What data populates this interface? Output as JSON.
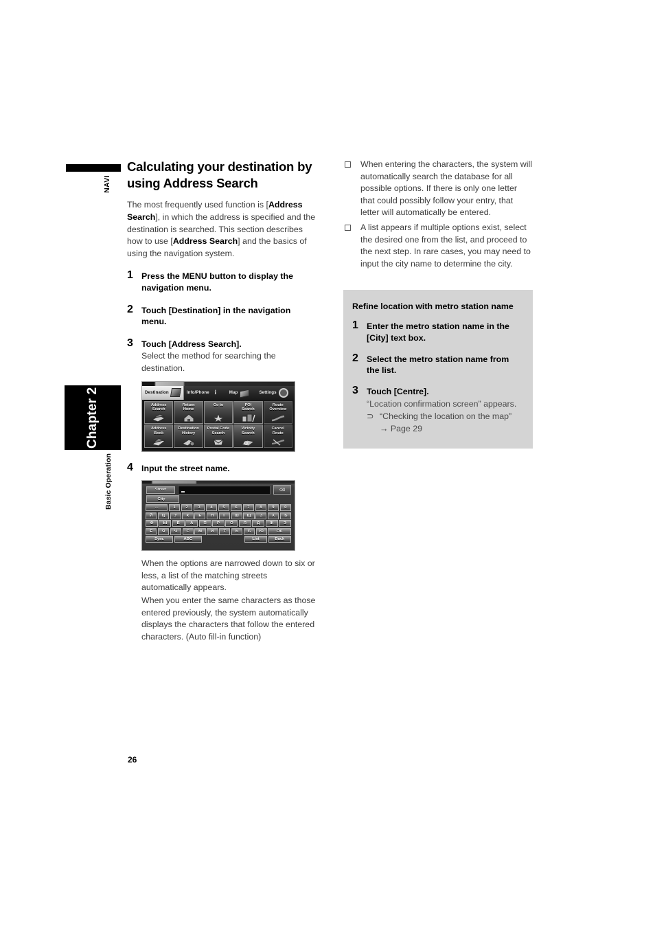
{
  "margin": {
    "navi_label": "NAVI",
    "chapter_label": "Chapter 2",
    "section_label": "Basic Operation",
    "page_number": "26"
  },
  "left_column": {
    "title": "Calculating your destination by using Address Search",
    "intro_parts": {
      "p1": "The most frequently used function is [",
      "b1": "Address Search",
      "p2": "], in which the address is specified and the destination is searched. This section describes how to use [",
      "b2": "Address Search",
      "p3": "] and the basics of using the navigation system."
    },
    "steps": [
      {
        "num": "1",
        "title": "Press the MENU button to display the navigation menu.",
        "desc": ""
      },
      {
        "num": "2",
        "title": "Touch [Destination] in the navigation menu.",
        "desc": ""
      },
      {
        "num": "3",
        "title": "Touch [Address Search].",
        "desc": "Select the method for searching the destination."
      },
      {
        "num": "4",
        "title": "Input the street name.",
        "desc": ""
      }
    ],
    "after_keyboard_text_1": "When the options are narrowed down to six or less, a list of the matching streets automatically appears.",
    "after_keyboard_text_2": "When you enter the same characters as those entered previously, the system automatically displays the characters that follow the entered characters. (Auto fill-in function)"
  },
  "nav_menu_screenshot": {
    "tabs": [
      {
        "label": "Destination",
        "icon": "flag-icon",
        "active": true
      },
      {
        "label": "Info/Phone",
        "icon": "info-icon",
        "active": false
      },
      {
        "label": "Map",
        "icon": "map-icon",
        "active": false
      },
      {
        "label": "Settings",
        "icon": "gear-icon",
        "active": false
      }
    ],
    "grid": [
      {
        "label": "Address\nSearch",
        "icon": "address-search-icon",
        "dim": false
      },
      {
        "label": "Return\nHome",
        "icon": "home-icon",
        "dim": false
      },
      {
        "label": "Go to",
        "icon": "star-icon",
        "dim": false
      },
      {
        "label": "POI\nSearch",
        "icon": "poi-icon",
        "dim": false
      },
      {
        "label": "Route\nOverview",
        "icon": "route-overview-icon",
        "dim": true
      },
      {
        "label": "Address\nBook",
        "icon": "address-book-icon",
        "dim": false
      },
      {
        "label": "Destination\nHistory",
        "icon": "history-icon",
        "dim": false
      },
      {
        "label": "Postal Code\nSearch",
        "icon": "postal-code-icon",
        "dim": false
      },
      {
        "label": "Vicinity\nSearch",
        "icon": "vicinity-icon",
        "dim": false
      },
      {
        "label": "Cancel\nRoute",
        "icon": "cancel-route-icon",
        "dim": true
      }
    ]
  },
  "keyboard_screenshot": {
    "street_tag": "Street",
    "street_value": "",
    "city_tag": "City",
    "backspace_icon": "backspace-icon",
    "row_num": [
      "...",
      "1",
      "2",
      "3",
      "4",
      "5",
      "6",
      "7",
      "8",
      "9",
      "0"
    ],
    "row_1": [
      "Й",
      "Ц",
      "У",
      "К",
      "Е",
      "Н",
      "Г",
      "Ш",
      "Щ",
      "З",
      "Х",
      "Ъ"
    ],
    "row_2": [
      "Ф",
      "Ы",
      "В",
      "А",
      "П",
      "Р",
      "О",
      "Л",
      "Д",
      "Ж",
      "Э"
    ],
    "row_3": [
      "Ё",
      "Я",
      "Ч",
      "С",
      "М",
      "И",
      "Т",
      "Ь",
      "Б",
      "Ю"
    ],
    "ok_label": "OK",
    "sym_label": "Sym.",
    "abc_label": "ABC",
    "list_label": "List",
    "back_label": "Back"
  },
  "right_column": {
    "notes": [
      "When entering the characters, the system will automatically search the database for all possible options. If there is only one letter that could possibly follow your entry, that letter will automatically be entered.",
      "A list appears if multiple options exist, select the desired one from the list, and proceed to the next step. In rare cases, you may need to input the city name to determine the city."
    ],
    "callout": {
      "title": "Refine location with metro station name",
      "background_color": "#d4d4d4",
      "steps": [
        {
          "num": "1",
          "title": "Enter the metro station name in the [City] text box.",
          "desc": ""
        },
        {
          "num": "2",
          "title": "Select the metro station name from the list.",
          "desc": ""
        },
        {
          "num": "3",
          "title": "Touch [Centre].",
          "desc": "“Location confirmation screen” appears."
        }
      ],
      "reference": {
        "arrow_icon": "⊃",
        "text": "“Checking the location on the map” → Page 29"
      }
    }
  }
}
